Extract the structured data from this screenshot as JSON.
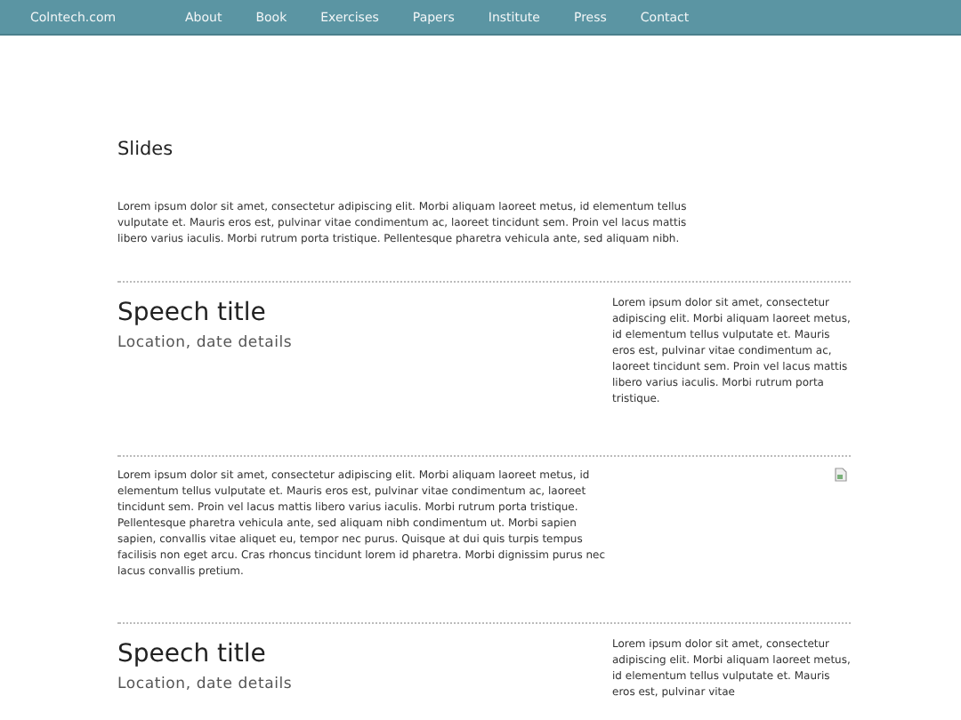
{
  "nav": {
    "brand": "Colntech.com",
    "links": [
      {
        "label": "About"
      },
      {
        "label": "Book"
      },
      {
        "label": "Exercises"
      },
      {
        "label": "Papers"
      },
      {
        "label": "Institute"
      },
      {
        "label": "Press"
      },
      {
        "label": "Contact"
      }
    ]
  },
  "heading": "Slides",
  "sections": [
    {
      "kind": "text",
      "text": "Lorem ipsum dolor sit amet, consectetur adipiscing elit.  Morbi aliquam laoreet metus, id elementum tellus vulputate et.  Mauris eros est, pulvinar vitae condimentum ac, laoreet tincidunt sem.  Proin vel lacus mattis libero varius iaculis.  Morbi rutrum porta tristique.  Pellentesque pharetra vehicula ante, sed aliquam nibh."
    },
    {
      "kind": "speech",
      "title": "Speech title",
      "details": "Location, date details",
      "text": "Lorem ipsum dolor sit amet, consectetur adipiscing elit.  Morbi aliquam laoreet metus, id elementum tellus vulputate et.  Mauris eros est, pulvinar vitae condimentum ac, laoreet tincidunt sem.  Proin vel lacus mattis libero varius iaculis.  Morbi rutrum porta tristique."
    },
    {
      "kind": "image_text",
      "text": "Lorem ipsum dolor sit amet, consectetur adipiscing elit.  Morbi aliquam laoreet metus, id elementum tellus vulputate et.  Mauris eros est, pulvinar vitae condimentum ac, laoreet tincidunt sem.  Proin vel lacus mattis libero varius iaculis.  Morbi rutrum porta tristique.  Pellentesque pharetra vehicula ante, sed aliquam nibh condimentum ut.  Morbi sapien sapien, convallis vitae aliquet eu, tempor nec purus. Quisque at dui quis turpis tempus facilisis non eget arcu. Cras rhoncus tincidunt lorem id pharetra.  Morbi dignissim purus nec lacus convallis pretium."
    },
    {
      "kind": "speech",
      "title": "Speech title",
      "details": "Location, date details",
      "text": "Lorem ipsum dolor sit amet, consectetur adipiscing elit.  Morbi aliquam laoreet metus, id elementum tellus vulputate et.  Mauris eros est, pulvinar vitae"
    }
  ]
}
